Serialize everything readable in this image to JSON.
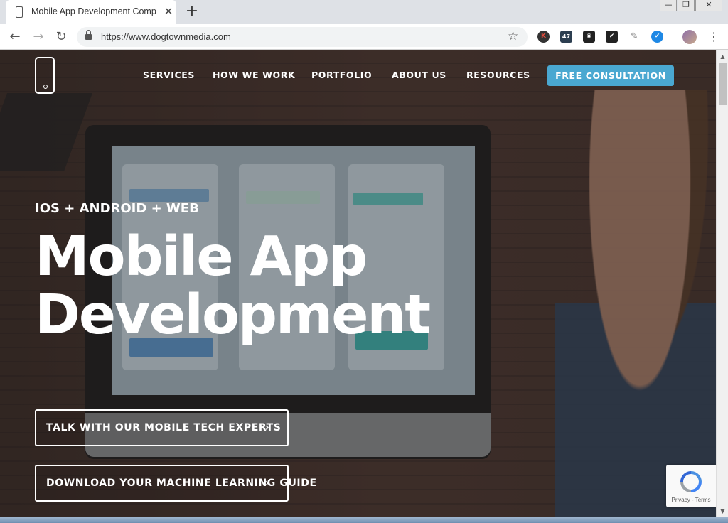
{
  "browser": {
    "tab_title": "Mobile App Development Comp",
    "tab_close": "✕",
    "new_tab": "+",
    "window_controls": {
      "minimize": "—",
      "maximize": "❐",
      "close": "✕"
    },
    "nav": {
      "back": "←",
      "forward": "→",
      "reload": "↻"
    },
    "url": "https://www.dogtownmedia.com",
    "star": "☆",
    "extensions": [
      {
        "name": "k-extension-icon",
        "label": "K"
      },
      {
        "name": "47-extension-icon",
        "label": "47"
      },
      {
        "name": "camera-extension-icon",
        "label": "◉"
      },
      {
        "name": "checkmark-extension-icon",
        "label": "✔"
      },
      {
        "name": "brush-extension-icon",
        "label": "✎"
      },
      {
        "name": "verified-badge-extension-icon",
        "label": "✔"
      }
    ],
    "menu": "⋮"
  },
  "site": {
    "nav": {
      "services": "SERVICES",
      "how_we_work": "HOW WE WORK",
      "portfolio": "PORTFOLIO",
      "about_us": "ABOUT US",
      "resources": "RESOURCES",
      "cta": "FREE CONSULTATION"
    },
    "hero": {
      "eyebrow": "IOS + ANDROID + WEB",
      "title_line1": "Mobile App",
      "title_line2": "Development",
      "button1": "TALK WITH OUR MOBILE TECH EXPERTS",
      "button2": "DOWNLOAD YOUR MACHINE LEARNING GUIDE",
      "arrow": "›"
    },
    "recaptcha": {
      "text": "Privacy - Terms"
    }
  },
  "scrollbar": {
    "up": "▲",
    "down": "▼"
  },
  "colors": {
    "accent": "#4aa8d1",
    "white": "#ffffff"
  }
}
